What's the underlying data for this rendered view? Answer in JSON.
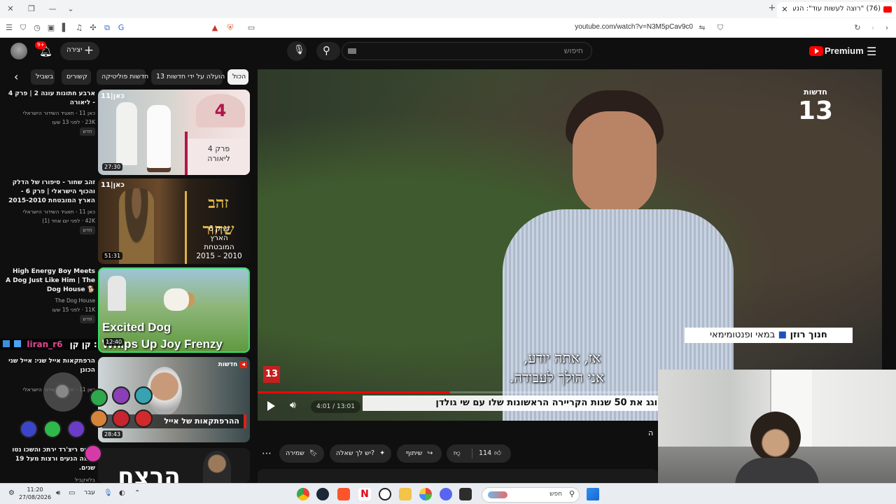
{
  "browser": {
    "tab_title": "(76) \"רוצה לעשות עוד\": הנער",
    "url": "youtube.com/watch?v=N3M5pCav9c0"
  },
  "header": {
    "logo_label": "Premium",
    "search_placeholder": "חיפוש",
    "create_label": "יצירה",
    "notifications_count": "9+"
  },
  "chips": [
    {
      "label": "הכול",
      "active": true
    },
    {
      "label": "הועלה על ידי חדשות 13",
      "active": false
    },
    {
      "label": "חדשות פוליטיקה",
      "active": false
    },
    {
      "label": "קשורים",
      "active": false
    },
    {
      "label": "בשביל",
      "active": false
    }
  ],
  "recommendations": [
    {
      "title": "ארבע חתונות עונה 2 | פרק 4 - ליאורה",
      "channel": "כאן 11 - תאגיד השידור הישראלי",
      "views_time": "23K · לפני 13 שעו",
      "badge": "חדש",
      "duration": "27:30",
      "thumb_text": "פרק 4\nליאורה",
      "thumb_tag": "ארבע חתונות"
    },
    {
      "title": "זהב שחור - סיפורו של הדלק והכוף הישראלי | פרק 6 - הארץ המובטחת 2015-2010",
      "channel": "כאן 11 - תאגיד השידור הישראלי",
      "views_time": "42K · לפני יום אחד (1)",
      "badge": "חדש",
      "duration": "51:31",
      "thumb_text": "פרק 6\nהארץ\nהמובטחת\n2015 – 2010",
      "thumb_tag": "זהב שחור"
    },
    {
      "title": "High Energy Boy Meets A Dog Just Like Him | The Dog House 🐕",
      "channel": "The Dog House",
      "views_time": "11K · לפני 15 שעו",
      "badge": "חדש",
      "duration": "12:40",
      "thumb_text": "Excited Dog\nWhips Up Joy Frenzy",
      "thumb_tag": ""
    },
    {
      "title": "הרפתקאות אייל שני: אייל שני הכונן",
      "channel": "כאן 11 - תאגיד השידור הישראלי",
      "views_time": "",
      "badge": "",
      "duration": "28:43",
      "thumb_text": "ההרפתקאות של אייל",
      "thumb_tag": "חדשות"
    },
    {
      "title": "מקיס ריצ'רד ירתכ והשכו נטו אומה הנעים ורצות מעל 19 שנים.",
      "channel": "בלאקביל",
      "views_time": "",
      "badge": "",
      "duration": "",
      "thumb_text": "הרצח",
      "thumb_tag": ""
    }
  ],
  "player": {
    "channel_logo": "חדשות 13",
    "subtitle_line1": "אז, אתה יודע,",
    "subtitle_line2": "אני הולך לעבודה.",
    "lower_third_name": "חנוך רוזן",
    "lower_third_role": "במאי ופנטומימאי",
    "ticker": "חוגג את 50 שנות הקריירה הראשונות שלו עם שי גולדן",
    "time_current": "4:01",
    "time_total": "13:01",
    "progress": 0.308
  },
  "actions": {
    "likes": "114",
    "share": "שיתוף",
    "ask": "יש לך שאלה?",
    "save": "שמירה"
  },
  "overlay": {
    "streamer_name": "liran_r6",
    "prefix": "קן קן :"
  },
  "taskbar": {
    "time": "11:20",
    "date": "27/08/2026",
    "lang": "עבר",
    "search_placeholder": "חפש"
  },
  "colors": {
    "yt_red": "#ff0000",
    "bg": "#0f0f0f",
    "chip": "#272727"
  }
}
